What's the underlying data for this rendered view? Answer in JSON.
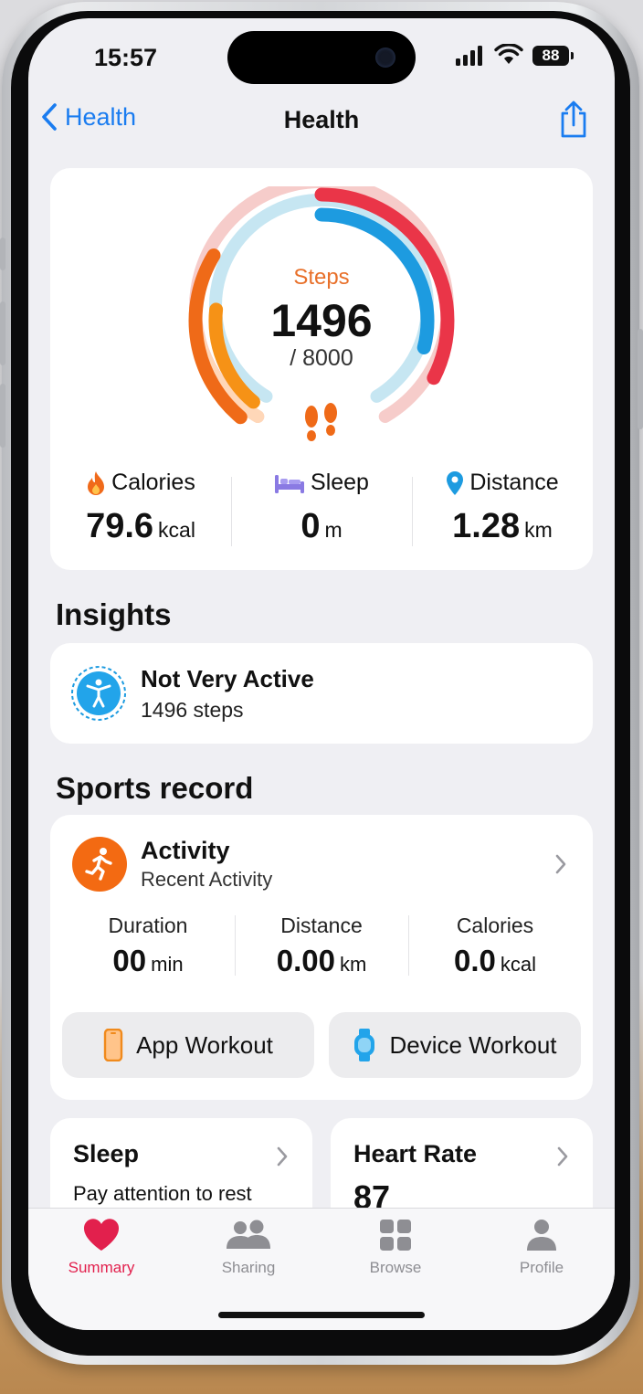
{
  "status": {
    "time": "15:57",
    "battery": "88"
  },
  "nav": {
    "back_label": "Health",
    "title": "Health"
  },
  "summary": {
    "steps_label": "Steps",
    "steps_value": "1496",
    "steps_goal": "/ 8000",
    "rings": {
      "move_fraction": 0.19,
      "steps_fraction": 0.187,
      "exercise_fraction": 0.2
    },
    "calories": {
      "label": "Calories",
      "value": "79.6",
      "unit": "kcal"
    },
    "sleep": {
      "label": "Sleep",
      "value": "0",
      "unit": "m"
    },
    "distance": {
      "label": "Distance",
      "value": "1.28",
      "unit": "km"
    }
  },
  "insights": {
    "heading": "Insights",
    "title": "Not Very Active",
    "subtitle": "1496 steps"
  },
  "sports": {
    "heading": "Sports record",
    "activity_title": "Activity",
    "activity_subtitle": "Recent Activity",
    "duration": {
      "label": "Duration",
      "value": "00",
      "unit": "min"
    },
    "distance": {
      "label": "Distance",
      "value": "0.00",
      "unit": "km"
    },
    "calories": {
      "label": "Calories",
      "value": "0.0",
      "unit": "kcal"
    },
    "app_workout": "App Workout",
    "device_workout": "Device Workout"
  },
  "sleep_card": {
    "title": "Sleep",
    "subtitle": "Pay attention to rest"
  },
  "heart_card": {
    "title": "Heart Rate",
    "value": "87"
  },
  "tabs": [
    {
      "label": "Summary",
      "icon": "heart-icon"
    },
    {
      "label": "Sharing",
      "icon": "people-icon"
    },
    {
      "label": "Browse",
      "icon": "grid-icon"
    },
    {
      "label": "Profile",
      "icon": "person-icon"
    }
  ],
  "colors": {
    "accent": "#1a7cf0",
    "active_tab": "#e2204d",
    "steps": "#e8702a"
  }
}
